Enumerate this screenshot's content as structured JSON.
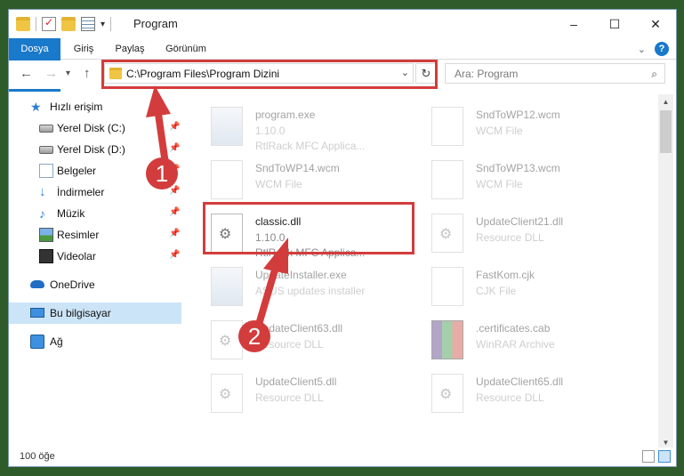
{
  "window": {
    "title": "Program"
  },
  "ribbon": {
    "tabs": [
      "Dosya",
      "Giriş",
      "Paylaş",
      "Görünüm"
    ]
  },
  "window_controls": {
    "minimize": "–",
    "maximize": "☐",
    "close": "✕"
  },
  "navigation": {
    "back": "←",
    "forward": "→",
    "recent": "▾",
    "up": "↑",
    "address": "C:\\Program Files\\Program Dizini",
    "refresh": "↻",
    "search_placeholder": "Ara: Program"
  },
  "sidebar": {
    "items": [
      {
        "label": "Hızlı erişim",
        "icon": "star-icon"
      },
      {
        "label": "Yerel Disk (C:)",
        "icon": "disk-icon",
        "pinned": true
      },
      {
        "label": "Yerel Disk (D:)",
        "icon": "disk-icon",
        "pinned": true
      },
      {
        "label": "Belgeler",
        "icon": "documents-icon",
        "pinned": true
      },
      {
        "label": "İndirmeler",
        "icon": "download-icon",
        "pinned": true
      },
      {
        "label": "Müzik",
        "icon": "music-icon",
        "pinned": true
      },
      {
        "label": "Resimler",
        "icon": "pictures-icon",
        "pinned": true
      },
      {
        "label": "Videolar",
        "icon": "videos-icon",
        "pinned": true
      },
      {
        "label": "OneDrive",
        "icon": "cloud-icon"
      },
      {
        "label": "Bu bilgisayar",
        "icon": "computer-icon",
        "selected": true
      },
      {
        "label": "Ağ",
        "icon": "network-icon"
      }
    ]
  },
  "files": [
    {
      "name": "program.exe",
      "line1": "1.10.0",
      "line2": "RtlRack MFC Applica...",
      "icon": "exe-icon"
    },
    {
      "name": "SndToWP12.wcm",
      "line1": "WCM File",
      "line2": "",
      "icon": "file-icon"
    },
    {
      "name": "SndToWP14.wcm",
      "line1": "WCM File",
      "line2": "",
      "icon": "file-icon"
    },
    {
      "name": "SndToWP13.wcm",
      "line1": "WCM File",
      "line2": "",
      "icon": "file-icon"
    },
    {
      "name": "classic.dll",
      "line1": "1.10.0",
      "line2": "RtlRack MFC Applica...",
      "icon": "dll-icon"
    },
    {
      "name": "UpdateClient21.dll",
      "line1": "Resource DLL",
      "line2": "",
      "icon": "dll-icon"
    },
    {
      "name": "UpdateInstaller.exe",
      "line1": "ASUS updates installer",
      "line2": "",
      "icon": "exe-icon"
    },
    {
      "name": "FastKom.cjk",
      "line1": "CJK File",
      "line2": "",
      "icon": "file-icon"
    },
    {
      "name": "UpdateClient63.dll",
      "line1": "Resource DLL",
      "line2": "",
      "icon": "dll-icon"
    },
    {
      "name": ".certificates.cab",
      "line1": "WinRAR Archive",
      "line2": "",
      "icon": "archive-icon"
    },
    {
      "name": "UpdateClient5.dll",
      "line1": "Resource DLL",
      "line2": "",
      "icon": "dll-icon"
    },
    {
      "name": "UpdateClient65.dll",
      "line1": "Resource DLL",
      "line2": "",
      "icon": "dll-icon"
    }
  ],
  "status": {
    "item_count": "100 öğe"
  },
  "annotations": {
    "step1": "1",
    "step2": "2",
    "color": "#d33c3c"
  }
}
